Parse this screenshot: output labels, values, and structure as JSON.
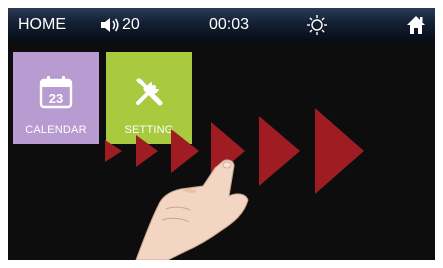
{
  "topbar": {
    "home_label": "HOME",
    "volume_value": "20",
    "clock": "00:03"
  },
  "tiles": {
    "calendar": {
      "label": "CALENDAR",
      "icon_day": "23"
    },
    "setting": {
      "label": "SETTING"
    }
  },
  "icons": {
    "volume": "speaker-icon",
    "brightness": "sun-icon",
    "home": "house-icon",
    "calendar": "calendar-icon",
    "setting": "tools-icon"
  },
  "colors": {
    "calendar_tile": "#b89bd0",
    "setting_tile": "#a9c93f",
    "arrow": "#9e1c22",
    "topbar": "#132033"
  }
}
